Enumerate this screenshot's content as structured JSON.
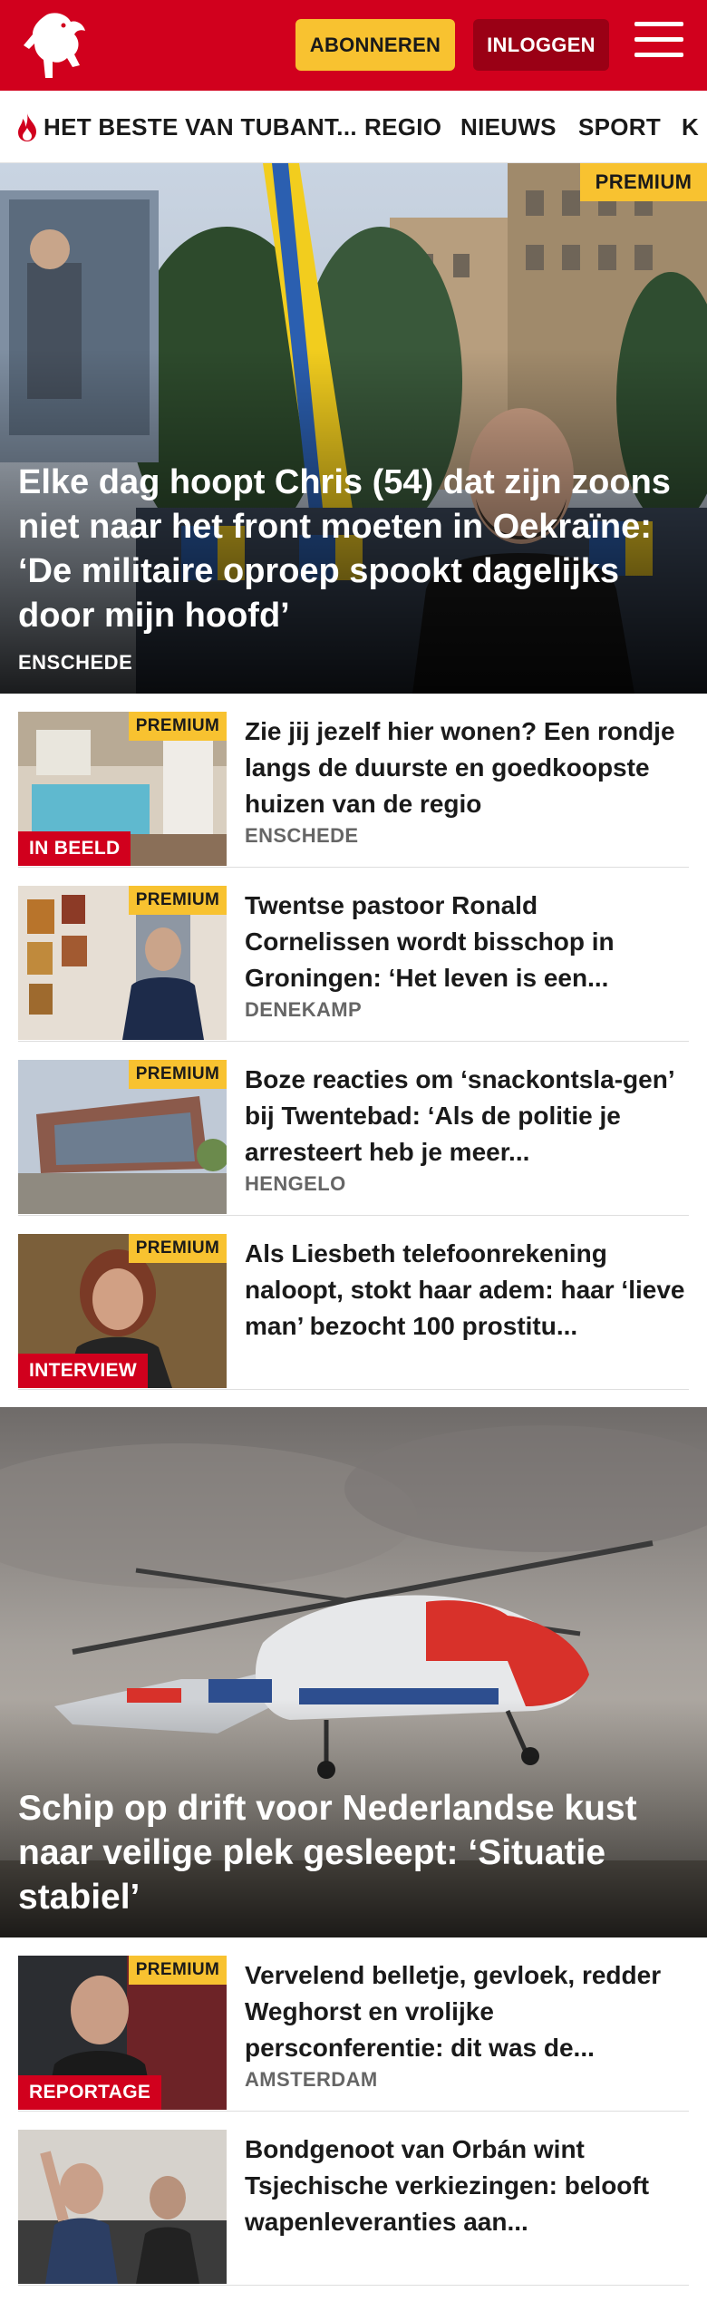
{
  "header": {
    "subscribe_label": "ABONNEREN",
    "login_label": "INLOGGEN",
    "brand_color": "#d1001d",
    "accent_color": "#f8c230",
    "icons": [
      "tubantia-horse-logo",
      "hamburger-menu-icon"
    ]
  },
  "nav": {
    "items": [
      {
        "label": "HET BESTE VAN TUBANT...",
        "icon": "flame-icon"
      },
      {
        "label": "REGIO"
      },
      {
        "label": "NIEUWS"
      },
      {
        "label": "SPORT"
      },
      {
        "label": "K"
      }
    ]
  },
  "hero": {
    "badge": "PREMIUM",
    "title": "Elke dag hoopt Chris (54) dat zijn zoons niet naar het front moeten in Oekraïne: ‘De militaire oproep spookt dagelijks door mijn hoofd’",
    "location": "ENSCHEDE"
  },
  "articles": [
    {
      "badge": "PREMIUM",
      "label": "IN BEELD",
      "title": "Zie jij jezelf hier wonen? Een rondje langs de duurste en goedkoopste huizen van de regio",
      "location": "ENSCHEDE"
    },
    {
      "badge": "PREMIUM",
      "label": "",
      "title": "Twentse pastoor Ronald Cornelissen wordt bisschop in Groningen: ‘Het leven is een...",
      "location": "DENEKAMP"
    },
    {
      "badge": "PREMIUM",
      "label": "",
      "title": "Boze reacties om ‘snackontsla-gen’ bij Twentebad: ‘Als de politie je arresteert heb je meer...",
      "location": "HENGELO"
    },
    {
      "badge": "PREMIUM",
      "label": "INTERVIEW",
      "title": "Als Liesbeth telefoonrekening naloopt, stokt haar adem: haar ‘lieve man’ bezocht 100 prostitu...",
      "location": ""
    }
  ],
  "big_story": {
    "title": "Schip op drift voor Nederlandse kust naar veilige plek gesleept: ‘Situatie stabiel’"
  },
  "articles2": [
    {
      "badge": "PREMIUM",
      "label": "REPORTAGE",
      "title": "Vervelend belletje, gevloek, redder Weghorst en vrolijke persconferentie: dit was de...",
      "location": "AMSTERDAM"
    },
    {
      "badge": "",
      "label": "",
      "title": "Bondgenoot van Orbán wint Tsjechische verkiezingen: belooft wapenleveranties aan...",
      "location": ""
    }
  ]
}
